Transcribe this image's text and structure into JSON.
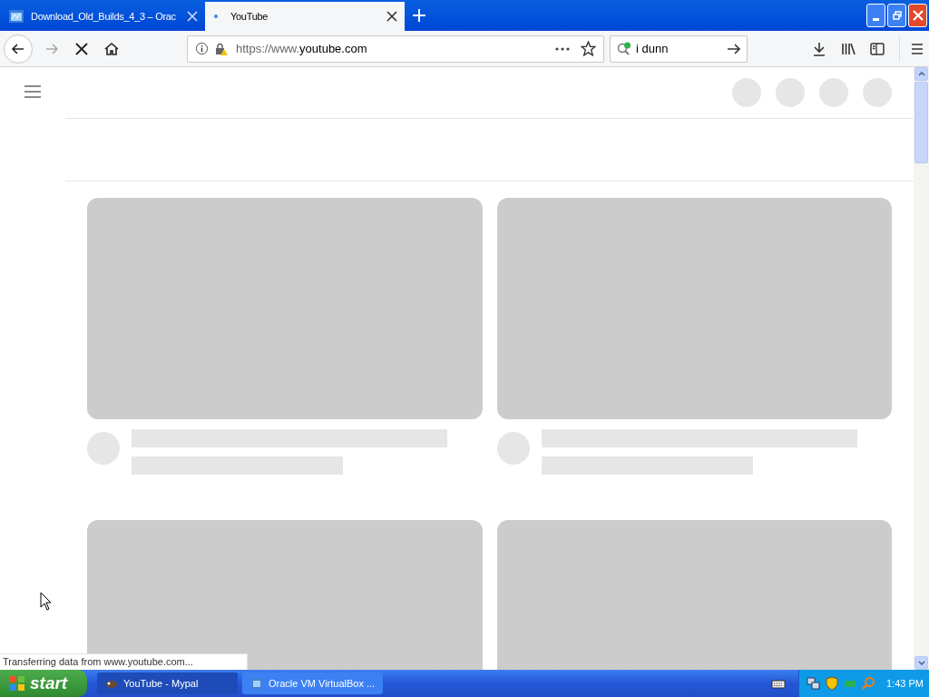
{
  "tabs": [
    {
      "title": "Download_Old_Builds_4_3 – Orac",
      "selected": false
    },
    {
      "title": "YouTube",
      "selected": true
    }
  ],
  "address_bar": {
    "url_prefix": "https://www.",
    "url_domain": "youtube.com"
  },
  "search": {
    "value": "i dunn"
  },
  "status_bar": "Transferring data from www.youtube.com...",
  "taskbar": {
    "start": "start",
    "buttons": [
      {
        "title": "YouTube - Mypal",
        "selected": true
      },
      {
        "title": "Oracle VM VirtualBox ...",
        "selected": false
      }
    ],
    "clock": "1:43 PM"
  }
}
